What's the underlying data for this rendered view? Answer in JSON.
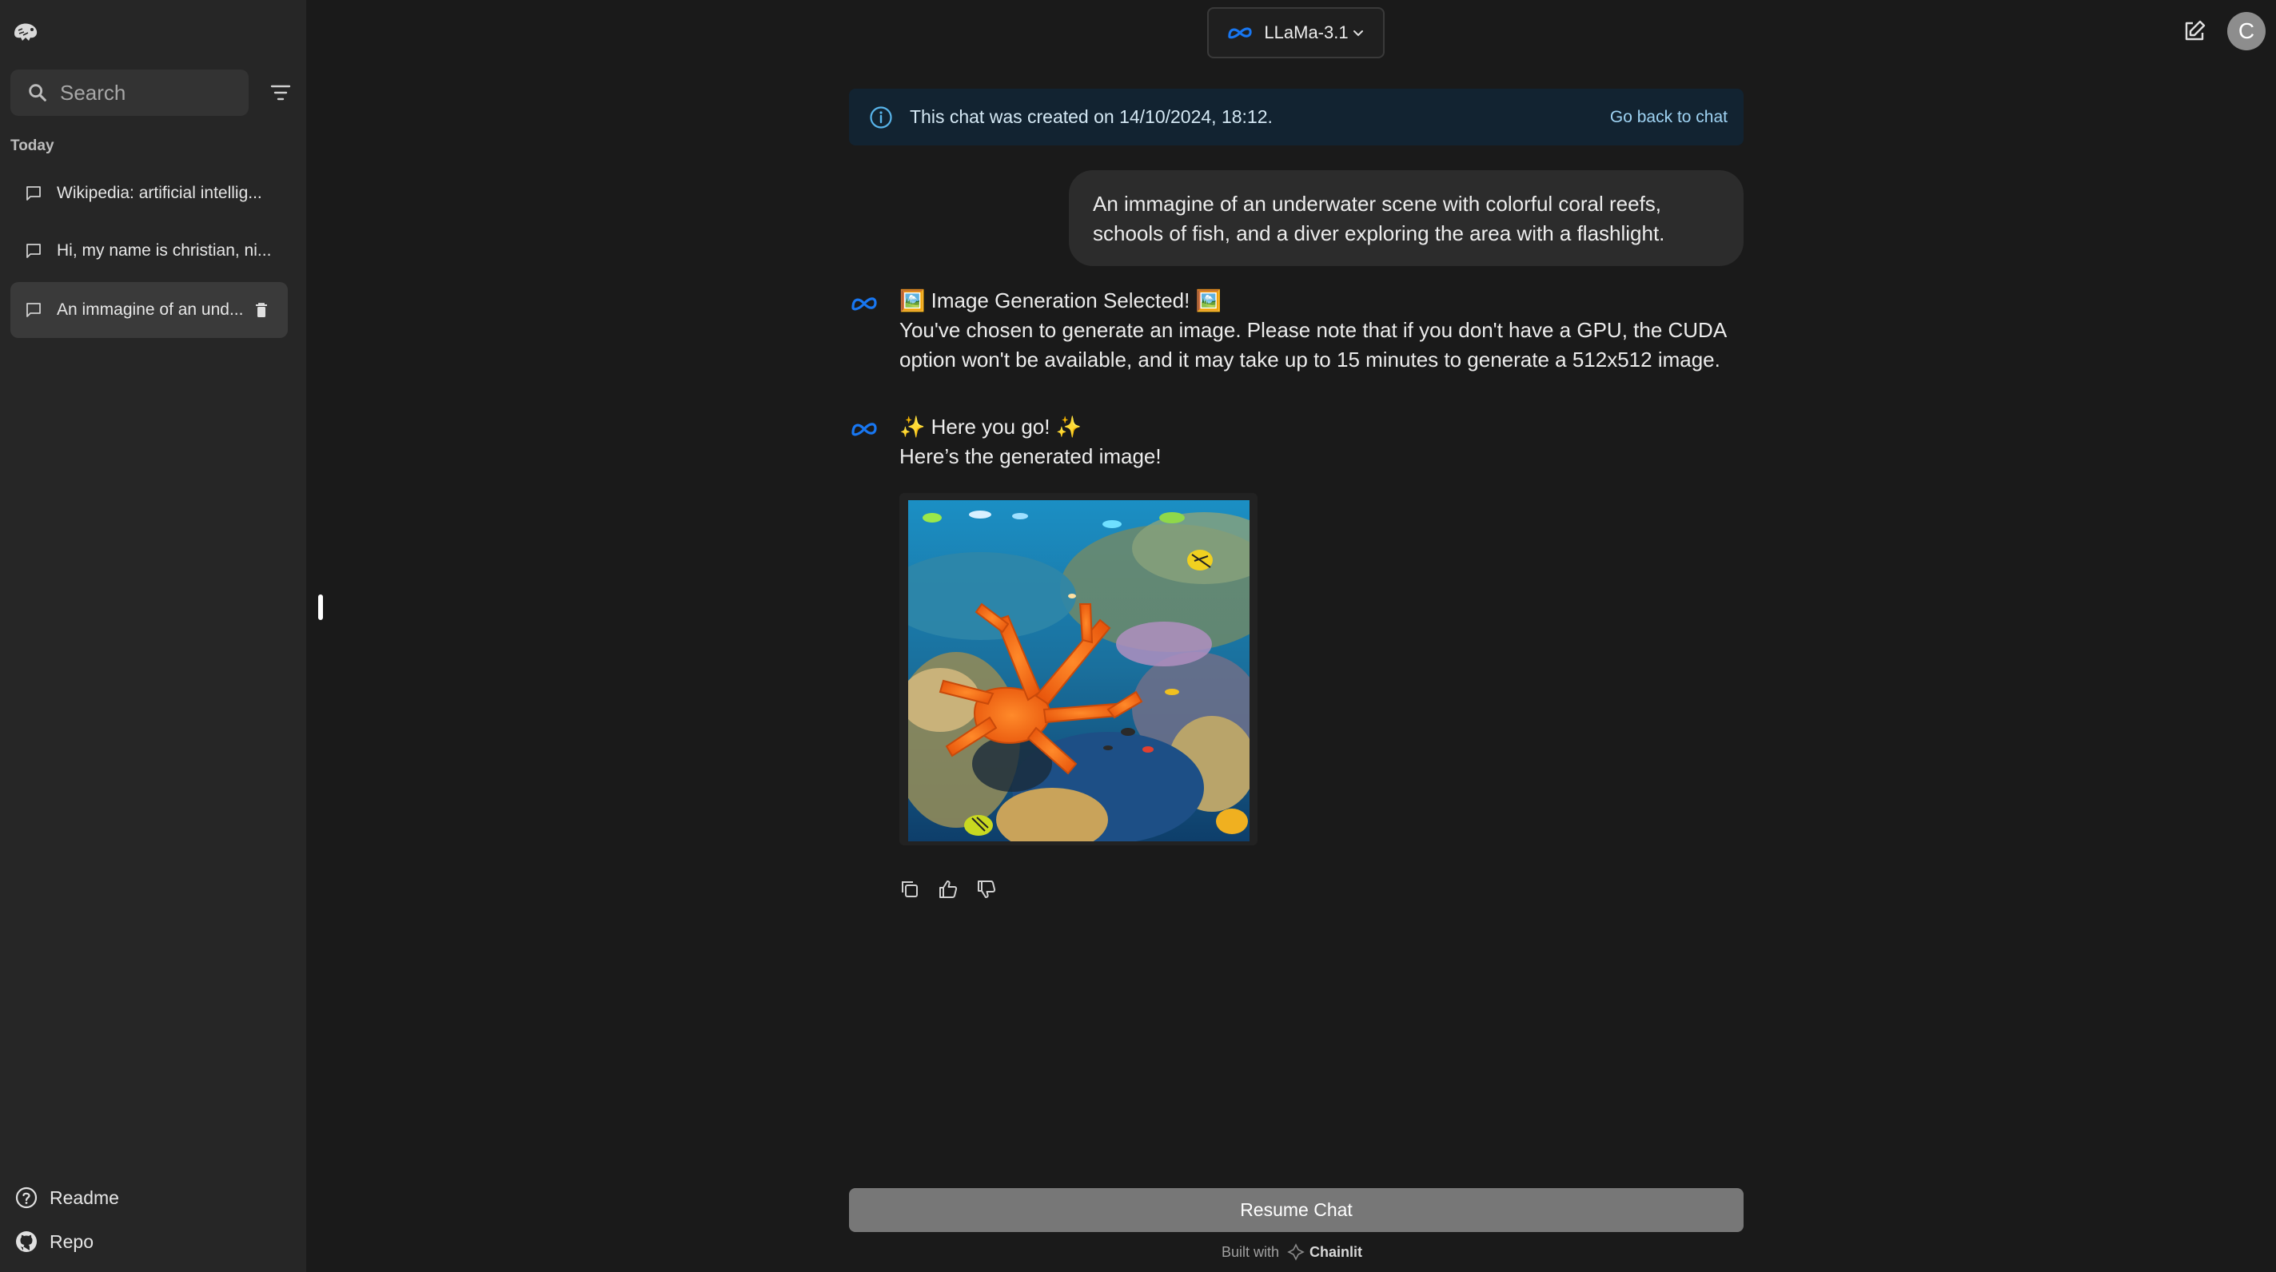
{
  "sidebar": {
    "search_placeholder": "Search",
    "section_label": "Today",
    "threads": [
      {
        "label": "Wikipedia: artificial intellig..."
      },
      {
        "label": "Hi, my name is christian, ni..."
      },
      {
        "label": "An immagine of an und..."
      }
    ],
    "links": [
      {
        "label": "Readme",
        "icon": "help-circle-icon"
      },
      {
        "label": "Repo",
        "icon": "github-icon"
      }
    ]
  },
  "header": {
    "model_label": "LLaMa-3.1",
    "avatar_initial": "C"
  },
  "banner": {
    "text": "This chat was created on 14/10/2024, 18:12.",
    "link": "Go back to chat"
  },
  "messages": {
    "user": {
      "line1": "An immagine of an underwater scene with colorful coral reefs,",
      "line2": "schools of fish, and a diver exploring the area with a flashlight."
    },
    "assistant1": {
      "line1": "🖼️ Image Generation Selected! 🖼️",
      "line2": "You've chosen to generate an image. Please note that if you don't have a GPU, the CUDA",
      "line3": "option won't be available, and it may take up to 15 minutes to generate a 512x512 image."
    },
    "assistant2": {
      "line1": "✨ Here you go! ✨",
      "line2": "Here’s the generated image!"
    }
  },
  "footer": {
    "resume_label": "Resume Chat",
    "built_with": "Built with",
    "brand": "Chainlit"
  },
  "colors": {
    "background": "#1a1a1a",
    "sidebar": "#262626",
    "accent_blue": "#1877f2",
    "banner_bg": "#122331"
  }
}
